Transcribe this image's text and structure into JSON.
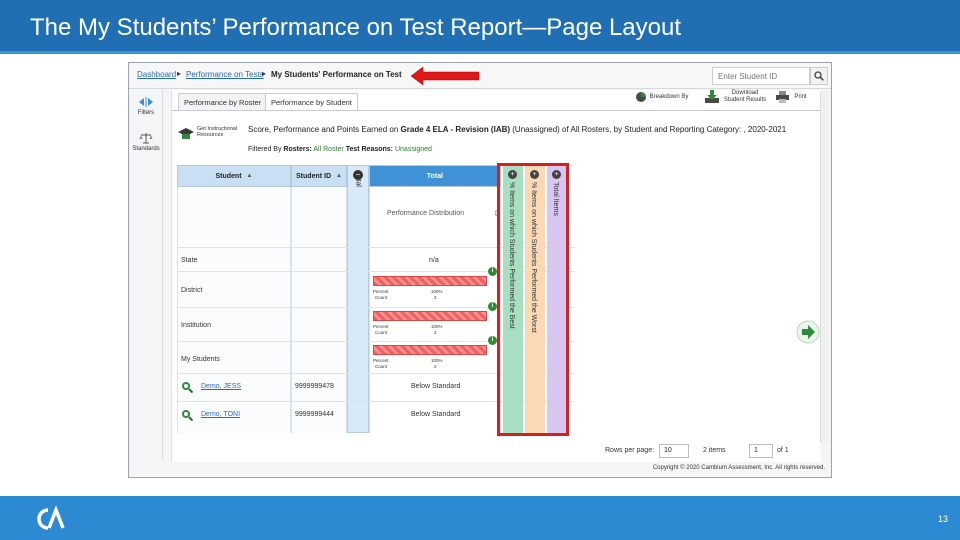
{
  "slide": {
    "title": "The My Students’ Performance on Test Report—Page Layout",
    "page_number": "13"
  },
  "breadcrumb": {
    "items": [
      "Dashboard",
      "Performance on Tests",
      "My Students' Performance on Test"
    ]
  },
  "search": {
    "placeholder": "Enter Student ID"
  },
  "left_rail": {
    "filters": "Filters",
    "standards": "Standards"
  },
  "tabs": [
    "Performance by Roster",
    "Performance by Student"
  ],
  "toolbar": {
    "breakdown": "Breakdown By",
    "download": "Download Student Results",
    "print": "Print"
  },
  "instructional_button": "Get Instructional Resources",
  "report": {
    "description_prefix": "Score, Performance and Points Earned on ",
    "assessment": "Grade 4 ELA - Revision (IAB)",
    "description_suffix": " (Unassigned) of All Rosters, by Student and Reporting Category: , 2020-2021",
    "filtered_by": "Filtered By",
    "rosters_label": "Rosters:",
    "rosters_value": "All Roster",
    "reasons_label": "Test Reasons:",
    "reasons_value": "Unassigned"
  },
  "table": {
    "headers": {
      "student": "Student",
      "student_id": "Student ID",
      "total_vertical": "Total",
      "total": "Total"
    },
    "perf_distribution": "Performance Distribution",
    "rows": [
      {
        "label": "State",
        "value": "n/a"
      },
      {
        "label": "District",
        "percent_label": "Percent",
        "count_label": "Count",
        "percent": "100%",
        "count": "2",
        "fill": 1.0
      },
      {
        "label": "Institution",
        "percent_label": "Percent",
        "count_label": "Count",
        "percent": "100%",
        "count": "2",
        "fill": 1.0
      },
      {
        "label": "My Students",
        "percent_label": "Percent",
        "count_label": "Count",
        "percent": "100%",
        "count": "2",
        "fill": 1.0
      }
    ],
    "students": [
      {
        "name": "Demo, JESS",
        "id": "9999999478",
        "result": "Below Standard"
      },
      {
        "name": "Demo, TONI",
        "id": "9999999444",
        "result": "Below Standard"
      }
    ],
    "vertical_columns": [
      {
        "label": "% Items on which Students Performed the Best",
        "color": "#a8dfc0"
      },
      {
        "label": "% Items on which Students Performed the Worst",
        "color": "#fbd9b5"
      },
      {
        "label": "Total Items",
        "color": "#d8c6f0"
      }
    ]
  },
  "pagination": {
    "rows_label": "Rows per page:",
    "rows_value": "10",
    "items_label": "2 items",
    "page_value": "1",
    "of_label": "of 1"
  },
  "copyright": "Copyright © 2020 Cambium Assessment, Inc. All rights reserved."
}
